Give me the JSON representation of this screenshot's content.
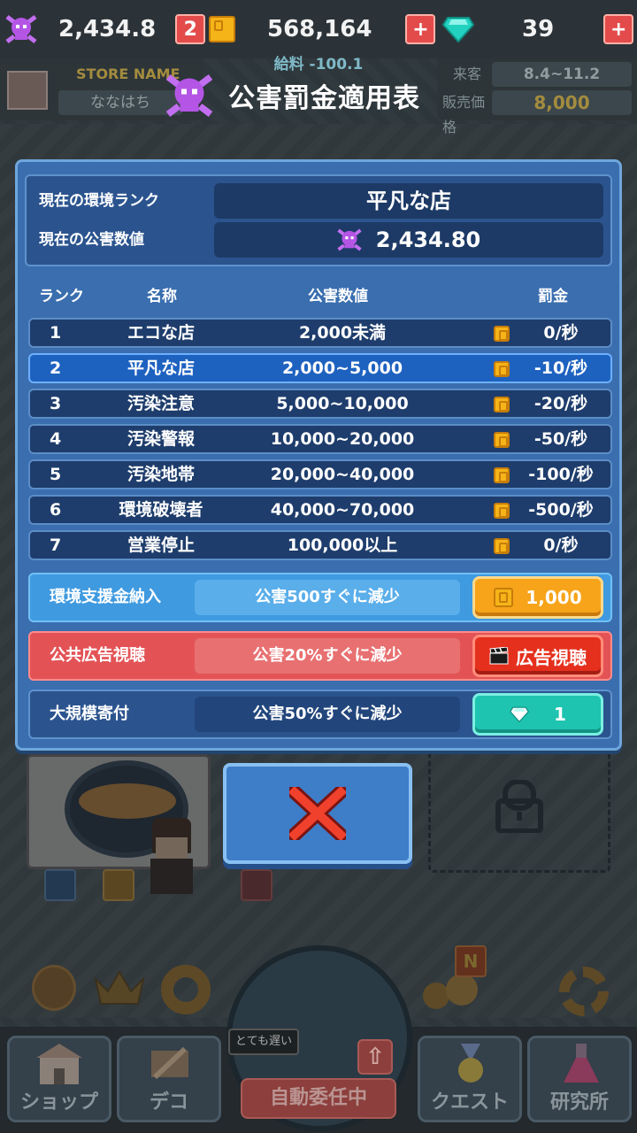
{
  "top": {
    "pollution_value": "2,434.8",
    "pollution_badge": "2",
    "coins": "568,164",
    "gems": "39",
    "salary": "給料 -100.1"
  },
  "store": {
    "name_label": "STORE NAME",
    "name_value": "ななはち",
    "visitors_label": "来客",
    "visitors_value": "8.4~11.2",
    "price_label": "販売価格",
    "price_value": "8,000"
  },
  "modal": {
    "title": "公害罰金適用表",
    "current_rank_label": "現在の環境ランク",
    "current_rank_value": "平凡な店",
    "current_pollution_label": "現在の公害数値",
    "current_pollution_value": "2,434.80",
    "headers": {
      "rank": "ランク",
      "name": "名称",
      "value": "公害数値",
      "fine": "罰金"
    },
    "rows": [
      {
        "rank": "1",
        "name": "エコな店",
        "value": "2,000未満",
        "fine": "0/秒",
        "current": false
      },
      {
        "rank": "2",
        "name": "平凡な店",
        "value": "2,000~5,000",
        "fine": "-10/秒",
        "current": true
      },
      {
        "rank": "3",
        "name": "汚染注意",
        "value": "5,000~10,000",
        "fine": "-20/秒",
        "current": false
      },
      {
        "rank": "4",
        "name": "汚染警報",
        "value": "10,000~20,000",
        "fine": "-50/秒",
        "current": false
      },
      {
        "rank": "5",
        "name": "汚染地帯",
        "value": "20,000~40,000",
        "fine": "-100/秒",
        "current": false
      },
      {
        "rank": "6",
        "name": "環境破壊者",
        "value": "40,000~70,000",
        "fine": "-500/秒",
        "current": false
      },
      {
        "rank": "7",
        "name": "営業停止",
        "value": "100,000以上",
        "fine": "0/秒",
        "current": false
      }
    ],
    "actions": {
      "support": {
        "label": "環境支援金納入",
        "desc": "公害500すぐに減少",
        "button": "1,000"
      },
      "ad": {
        "label": "公共広告視聴",
        "desc": "公害20%すぐに減少",
        "button": "広告視聴"
      },
      "donate": {
        "label": "大規模寄付",
        "desc": "公害50%すぐに減少",
        "button": "1"
      }
    }
  },
  "bottom_nav": {
    "shop": "ショップ",
    "deco": "デコ",
    "auto": "自動委任中",
    "speed": "とても遅い",
    "quest": "クエスト",
    "lab": "研究所",
    "new_badge": "N"
  },
  "colors": {
    "modal_bg": "#3a6eaf",
    "current_row": "#1e62c0",
    "coin": "#f5b417",
    "gem": "#1ec4b0",
    "danger": "#e5301d"
  }
}
